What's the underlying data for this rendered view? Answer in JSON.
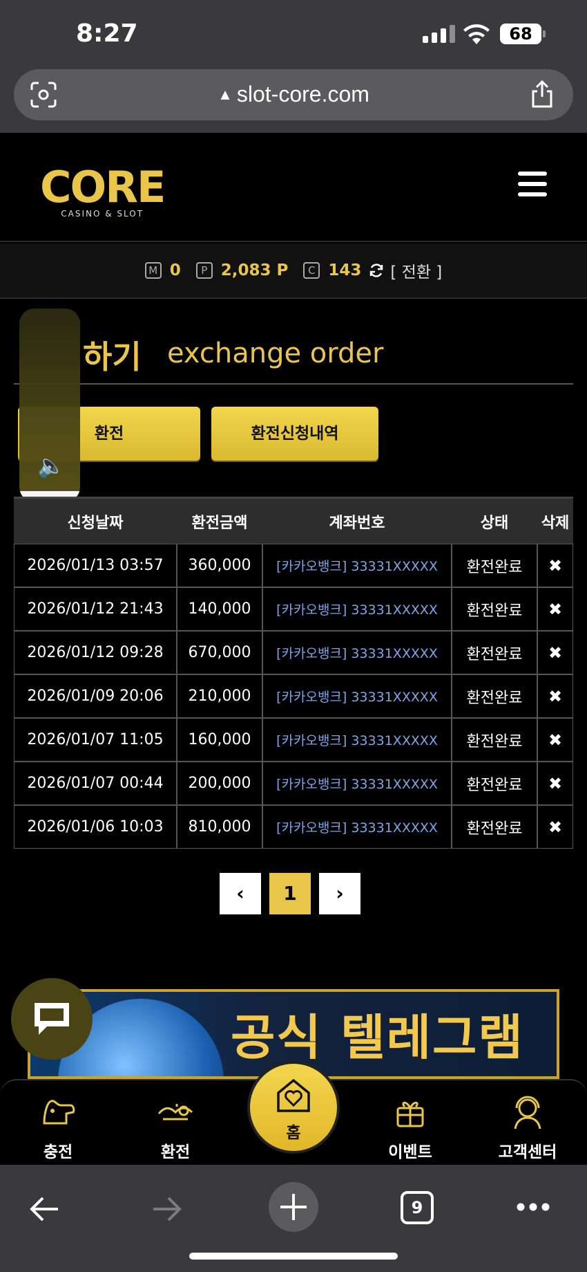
{
  "status_bar": {
    "time": "8:27",
    "battery": "68"
  },
  "browser": {
    "url": "slot-core.com"
  },
  "site": {
    "logo": "CORE",
    "logo_sub": "CASINO & SLOT"
  },
  "points": {
    "m_label": "M",
    "m_value": "0",
    "p_label": "P",
    "p_value": "2,083 P",
    "c_label": "C",
    "c_value": "143",
    "convert": "[ 전환 ]"
  },
  "page": {
    "title_ko": "하기",
    "title_en": "exchange order",
    "btn_exchange": "환전",
    "btn_history": "환전신청내역"
  },
  "table": {
    "headers": [
      "신청날짜",
      "환전금액",
      "계좌번호",
      "상태",
      "삭제"
    ],
    "rows": [
      {
        "date": "2026/01/13 03:57",
        "amount": "360,000",
        "account": "[카카오뱅크] 33331XXXXX",
        "status": "환전완료",
        "del": "✖"
      },
      {
        "date": "2026/01/12 21:43",
        "amount": "140,000",
        "account": "[카카오뱅크] 33331XXXXX",
        "status": "환전완료",
        "del": "✖"
      },
      {
        "date": "2026/01/12 09:28",
        "amount": "670,000",
        "account": "[카카오뱅크] 33331XXXXX",
        "status": "환전완료",
        "del": "✖"
      },
      {
        "date": "2026/01/09 20:06",
        "amount": "210,000",
        "account": "[카카오뱅크] 33331XXXXX",
        "status": "환전완료",
        "del": "✖"
      },
      {
        "date": "2026/01/07 11:05",
        "amount": "160,000",
        "account": "[카카오뱅크] 33331XXXXX",
        "status": "환전완료",
        "del": "✖"
      },
      {
        "date": "2026/01/07 00:44",
        "amount": "200,000",
        "account": "[카카오뱅크] 33331XXXXX",
        "status": "환전완료",
        "del": "✖"
      },
      {
        "date": "2026/01/06 10:03",
        "amount": "810,000",
        "account": "[카카오뱅크] 33331XXXXX",
        "status": "환전완료",
        "del": "✖"
      }
    ]
  },
  "pagination": {
    "prev": "‹",
    "current": "1",
    "next": "›"
  },
  "banner": {
    "text": "공식 텔레그램"
  },
  "bottom_nav": {
    "charge": "충전",
    "exchange": "환전",
    "home": "홈",
    "event": "이벤트",
    "support": "고객센터"
  },
  "safari": {
    "tabs_count": "9"
  },
  "colors": {
    "accent": "#e9c64a",
    "link": "#7ea5e6"
  }
}
